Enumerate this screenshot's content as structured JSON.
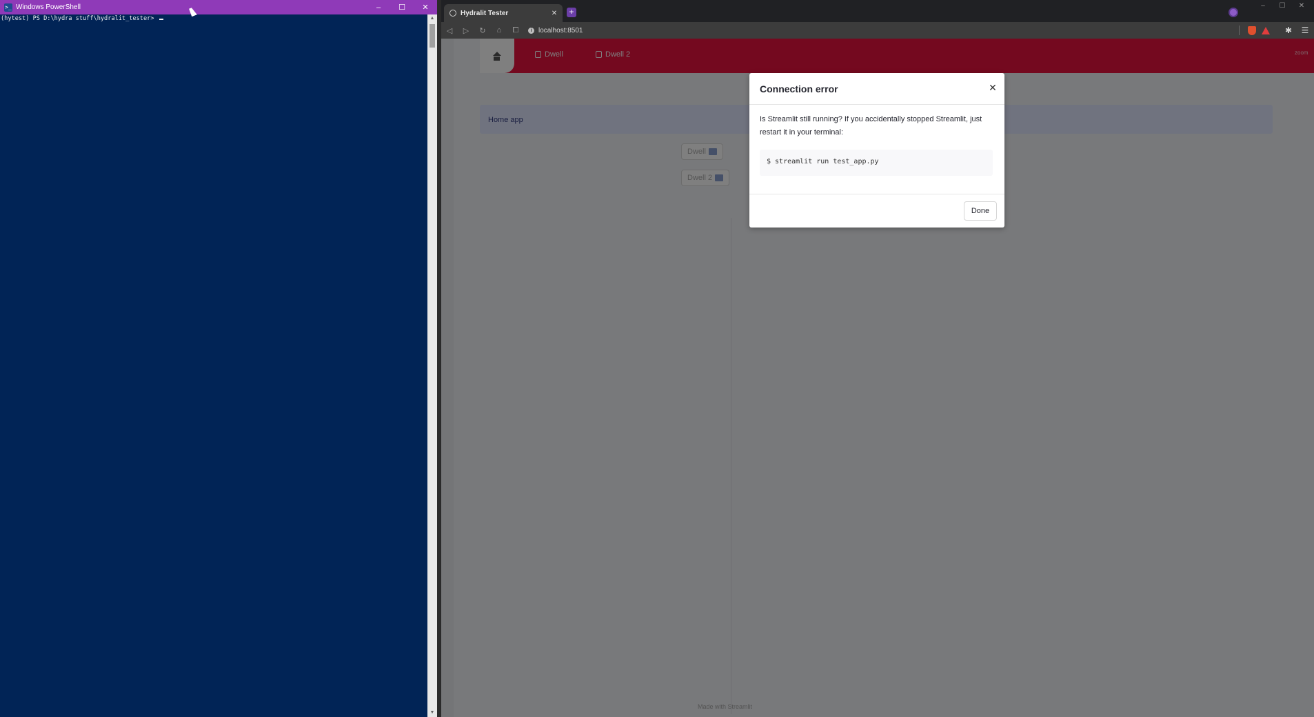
{
  "powershell": {
    "title": "Windows PowerShell",
    "logo_glyph": ">_",
    "prompt": "(hytest) PS D:\\hydra stuff\\hydralit_tester> ",
    "controls": {
      "minimize": "–",
      "maximize": "☐",
      "close": "✕"
    },
    "scroll_up": "▲",
    "scroll_down": "▼",
    "background_color": "#012456",
    "titlebar_color": "#8f3ab8"
  },
  "browser": {
    "tab_title": "Hydralit Tester",
    "tab_close": "✕",
    "new_tab": "+",
    "url": "localhost:8501",
    "url_info_glyph": "i",
    "nav": {
      "back": "◁",
      "forward": "▷",
      "reload": "↻",
      "home": "⌂",
      "bookmark": "⧠"
    },
    "window_controls": {
      "minimize": "–",
      "maximize": "☐",
      "close": "✕"
    },
    "extensions_glyph": "✱",
    "menu_glyph": "☰"
  },
  "app": {
    "nav_items": [
      {
        "label": "Dwell"
      },
      {
        "label": "Dwell 2"
      }
    ],
    "nav_corner_text": "zoom",
    "accent_color": "#e8123e",
    "home_label": "Home app",
    "buttons": [
      {
        "label": "Dwell"
      },
      {
        "label": "Dwell 2"
      }
    ],
    "footer_prefix": "Made with ",
    "footer_brand": "Streamlit"
  },
  "modal": {
    "title": "Connection error",
    "close_glyph": "✕",
    "body": "Is Streamlit still running? If you accidentally stopped Streamlit, just restart it in your terminal:",
    "code": "$ streamlit run test_app.py",
    "done_label": "Done"
  }
}
